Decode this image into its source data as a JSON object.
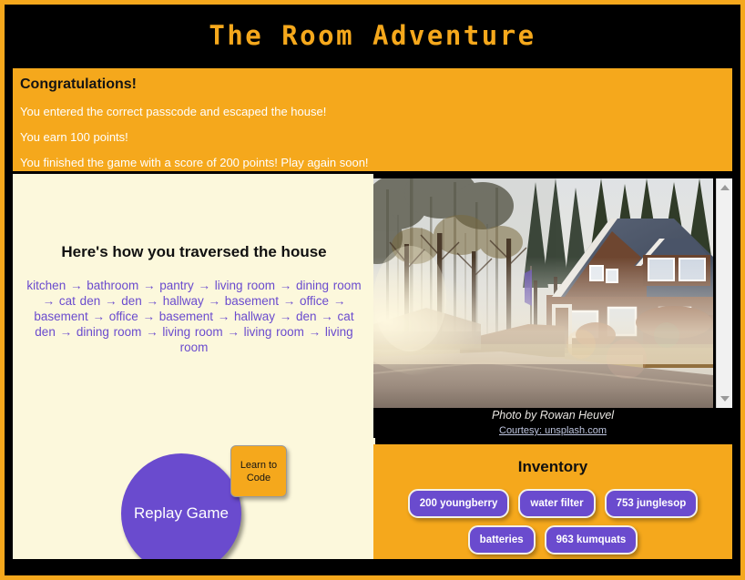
{
  "app": {
    "title": "The Room Adventure",
    "accent_orange": "#F5A81C",
    "panel_cream": "#FCF8DC",
    "accent_purple": "#6A4BCE",
    "background": "#000000"
  },
  "banner": {
    "heading": "Congratulations!",
    "lines": [
      "You entered the correct passcode and escaped the house!",
      "You earn 100 points!",
      "You finished the game with a score of 200 points! Play again soon!"
    ]
  },
  "traversal": {
    "heading": "Here's how you traversed the house",
    "path": "kitchen → bathroom → pantry → living room → dining room → cat den → den → hallway → basement → office → basement → office → basement → hallway → den → cat den → dining room → living room → living room → living room"
  },
  "buttons": {
    "replay": "Replay Game",
    "learn_to_code": "Learn to Code"
  },
  "photo": {
    "credit": "Photo by Rowan Heuvel",
    "courtesy": "Courtesy: unsplash.com",
    "alt": "Misty morning road beside a wooden house with a blue-grey roof surrounded by tall trees",
    "scrollbar": {
      "up_icon": "triangle-up-icon",
      "down_icon": "triangle-down-icon"
    }
  },
  "inventory": {
    "title": "Inventory",
    "items": [
      "200 youngberry",
      "water filter",
      "753 junglesop",
      "batteries",
      "963 kumquats"
    ]
  }
}
